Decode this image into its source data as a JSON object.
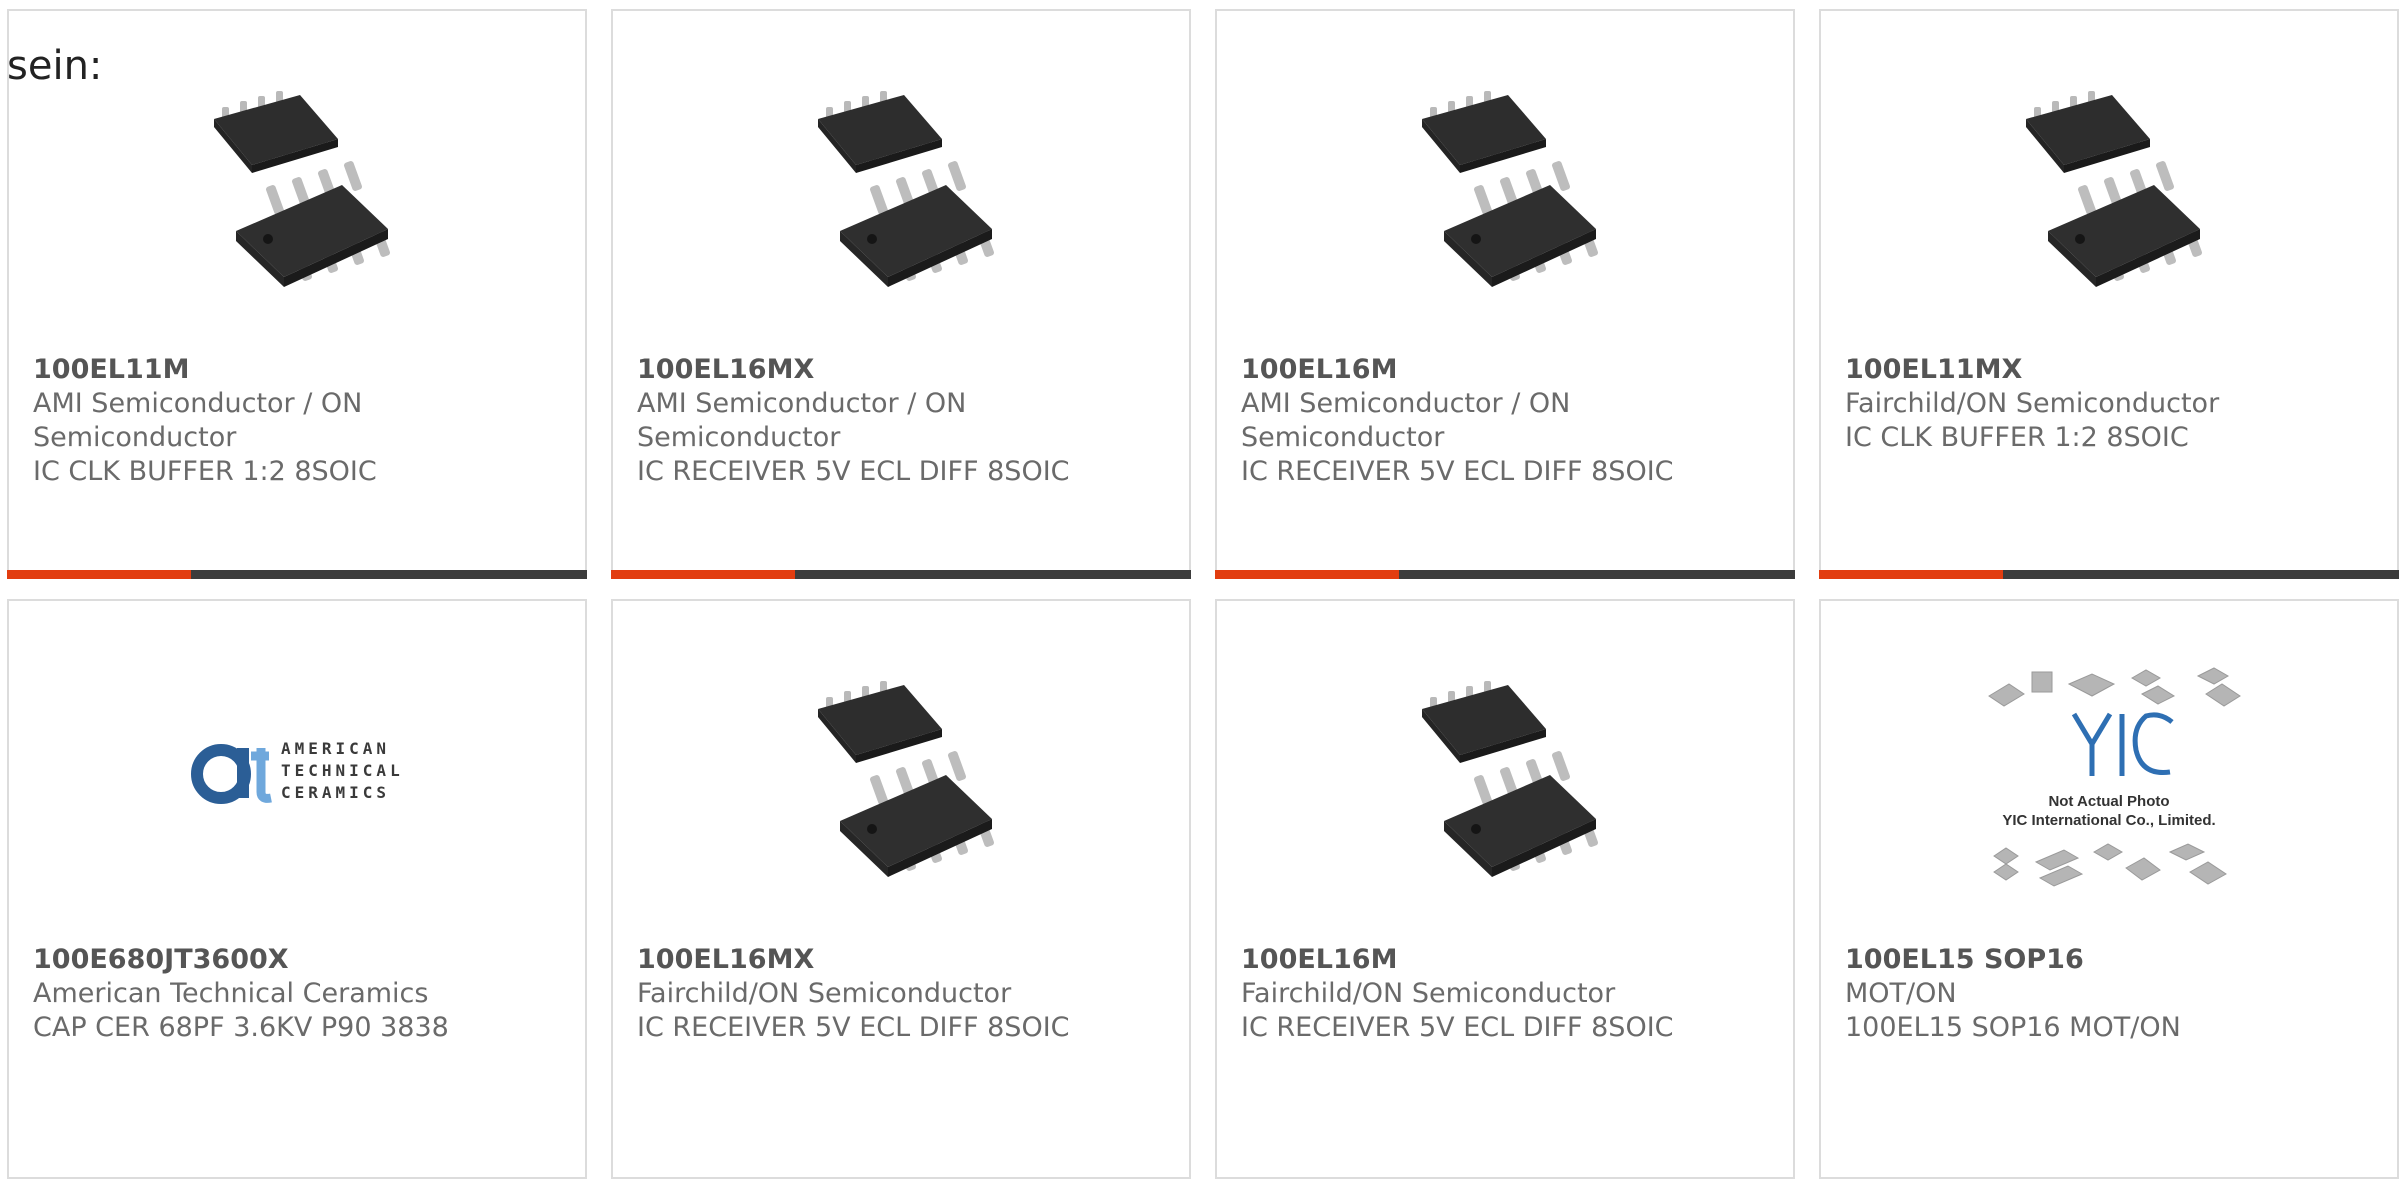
{
  "intro_text": "sein:",
  "accent_color": "#e23d10",
  "bar_color": "#3c3c3c",
  "products": [
    {
      "part": "100EL11M",
      "manufacturer": "AMI Semiconductor / ON Semiconductor",
      "description": "IC CLK BUFFER 1:2 8SOIC",
      "image_icon": "soic8-chip-icon"
    },
    {
      "part": "100EL16MX",
      "manufacturer": "AMI Semiconductor / ON Semiconductor",
      "description": "IC RECEIVER 5V ECL DIFF 8SOIC",
      "image_icon": "soic8-chip-icon"
    },
    {
      "part": "100EL16M",
      "manufacturer": "AMI Semiconductor / ON Semiconductor",
      "description": "IC RECEIVER 5V ECL DIFF 8SOIC",
      "image_icon": "soic8-chip-icon"
    },
    {
      "part": "100EL11MX",
      "manufacturer": "Fairchild/ON Semiconductor",
      "description": "IC CLK BUFFER 1:2 8SOIC",
      "image_icon": "soic8-chip-icon"
    },
    {
      "part": "100E680JT3600X",
      "manufacturer": "American Technical Ceramics",
      "description": "CAP CER 68PF 3.6KV P90 3838",
      "image_icon": "atc-logo",
      "logo_lines": [
        "AMERICAN",
        "TECHNICAL",
        "CERAMICS"
      ]
    },
    {
      "part": "100EL16MX",
      "manufacturer": "Fairchild/ON Semiconductor",
      "description": "IC RECEIVER 5V ECL DIFF 8SOIC",
      "image_icon": "soic8-chip-icon"
    },
    {
      "part": "100EL16M",
      "manufacturer": "Fairchild/ON Semiconductor",
      "description": "IC RECEIVER 5V ECL DIFF 8SOIC",
      "image_icon": "soic8-chip-icon"
    },
    {
      "part": "100EL15 SOP16",
      "manufacturer": "MOT/ON",
      "description": "100EL15 SOP16 MOT/ON",
      "image_icon": "yic-placeholder-image",
      "placeholder_lines": [
        "Not Actual Photo",
        "YIC International Co., Limited."
      ]
    }
  ]
}
